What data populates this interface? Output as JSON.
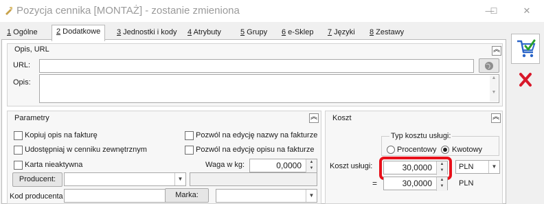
{
  "window": {
    "title": "Pozycja cennika [MONTAŻ] - zostanie zmieniona",
    "minimize": "—",
    "maximize": "☐",
    "close": "✕"
  },
  "tabs": [
    {
      "key": "1",
      "label": " Ogólne"
    },
    {
      "key": "2",
      "label": " Dodatkowe"
    },
    {
      "key": "3",
      "label": " Jednostki i kody"
    },
    {
      "key": "4",
      "label": " Atrybuty"
    },
    {
      "key": "5",
      "label": " Grupy"
    },
    {
      "key": "6",
      "label": " e-Sklep"
    },
    {
      "key": "7",
      "label": " Języki"
    },
    {
      "key": "8",
      "label": " Zestawy"
    }
  ],
  "opis_group": {
    "title": "Opis, URL",
    "url_label": "URL:",
    "url_value": "",
    "opis_label": "Opis:",
    "opis_value": ""
  },
  "parametry": {
    "title": "Parametry",
    "kopiuj_opis": "Kopiuj opis na fakturę",
    "udostepniaj": "Udostępniaj w cenniku zewnętrznym",
    "karta_nieaktywna": "Karta nieaktywna",
    "pozwol_nazwa": "Pozwól na edycję nazwy na fakturze",
    "pozwol_opis": "Pozwól na edycję opisu na fakturze",
    "waga_label": "Waga w kg:",
    "waga_value": "0,0000",
    "producent_button": "Producent:",
    "producent_value": "",
    "kod_producenta_label": "Kod producenta",
    "kod_producenta_value": "",
    "marka_button": "Marka:",
    "marka_value": ""
  },
  "koszt": {
    "title": "Koszt",
    "typ_label": "Typ kosztu usługi:",
    "procentowy": "Procentowy",
    "kwotowy": "Kwotowy",
    "selected": "Kwotowy",
    "koszt_uslugi_label": "Koszt usługi:",
    "koszt_uslugi_value": "30,0000",
    "currency": "PLN",
    "equals": "=",
    "koszt_pln_value": "30,0000",
    "currency2": "PLN",
    "highlight_color": "#e8101a"
  }
}
